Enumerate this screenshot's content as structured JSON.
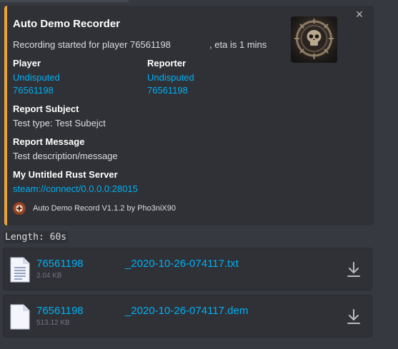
{
  "embed": {
    "accent_color": "#e8a33a",
    "close_symbol": "×",
    "title": "Auto Demo Recorder",
    "description": "Recording started for player 76561198               , eta is 1 mins",
    "fields": {
      "player_name": "Player",
      "player_value_1": "Undisputed",
      "player_value_2": "76561198",
      "reporter_name": "Reporter",
      "reporter_value_1": "Undisputed",
      "reporter_value_2": "76561198",
      "subject_name": "Report Subject",
      "subject_value": "Test type: Test Subejct",
      "message_name": "Report Message",
      "message_value": "Test description/message",
      "server_name": "My Untitled Rust Server",
      "server_value": "steam://connect/0.0.0.0:28015"
    },
    "footer_text": "Auto Demo Record V1.1.2 by Pho3niX90"
  },
  "length": {
    "label": "Length:",
    "value": "60s"
  },
  "attachments": [
    {
      "name": "76561198              _2020-10-26-074117.txt",
      "size": "2.04 KB"
    },
    {
      "name": "76561198              _2020-10-26-074117.dem",
      "size": "513.12 KB"
    }
  ],
  "colors": {
    "background": "#36393f",
    "embed_background": "#2f3136",
    "link": "#00b0f4"
  }
}
